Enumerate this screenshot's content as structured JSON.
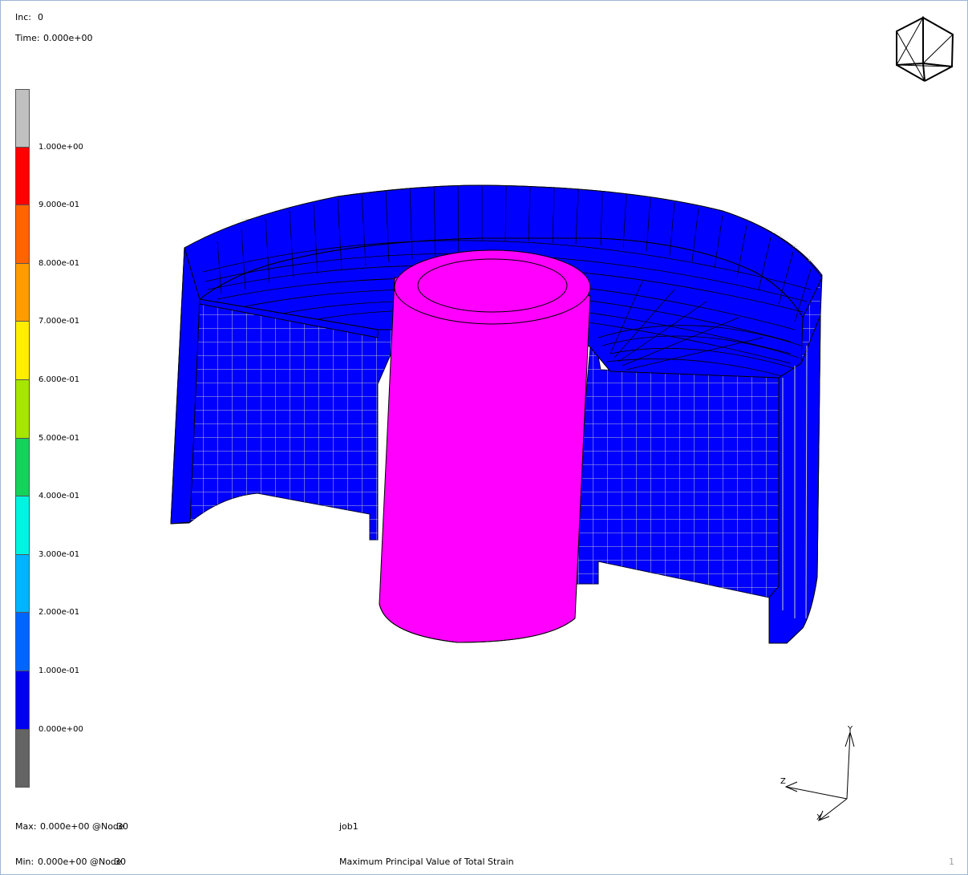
{
  "header": {
    "inc_label": "Inc:",
    "inc_value": "0",
    "time_label": "Time:",
    "time_value": "0.000e+00"
  },
  "legend": {
    "bands": [
      {
        "color": "#c0c0c0",
        "label": ""
      },
      {
        "color": "#ff0000",
        "label": "1.000e+00"
      },
      {
        "color": "#ff6400",
        "label": "9.000e-01"
      },
      {
        "color": "#ff9d00",
        "label": "8.000e-01"
      },
      {
        "color": "#ffee00",
        "label": "7.000e-01"
      },
      {
        "color": "#a6e600",
        "label": "6.000e-01"
      },
      {
        "color": "#14d25a",
        "label": "5.000e-01"
      },
      {
        "color": "#00f5e0",
        "label": "4.000e-01"
      },
      {
        "color": "#00b4ff",
        "label": "3.000e-01"
      },
      {
        "color": "#0064ff",
        "label": "2.000e-01"
      },
      {
        "color": "#0000f0",
        "label": "1.000e-01"
      },
      {
        "color": "#646464",
        "label": "0.000e+00"
      }
    ]
  },
  "model_colors": {
    "workpiece": "#0000ff",
    "punch": "#ff00ff",
    "mesh_line_outer": "#c8c8c8",
    "mesh_line_inner": "#000000"
  },
  "axes": {
    "y_label": "Y",
    "z_label": "Z",
    "x_label": "X"
  },
  "footer": {
    "max_label": "Max:",
    "max_value": "0.000e+00 @Node",
    "max_node": "30",
    "min_label": "Min:",
    "min_value": "0.000e+00 @Node",
    "min_node": "30",
    "job_name": "job1",
    "result_name": "Maximum Principal Value of Total Strain",
    "page_number": "1"
  }
}
